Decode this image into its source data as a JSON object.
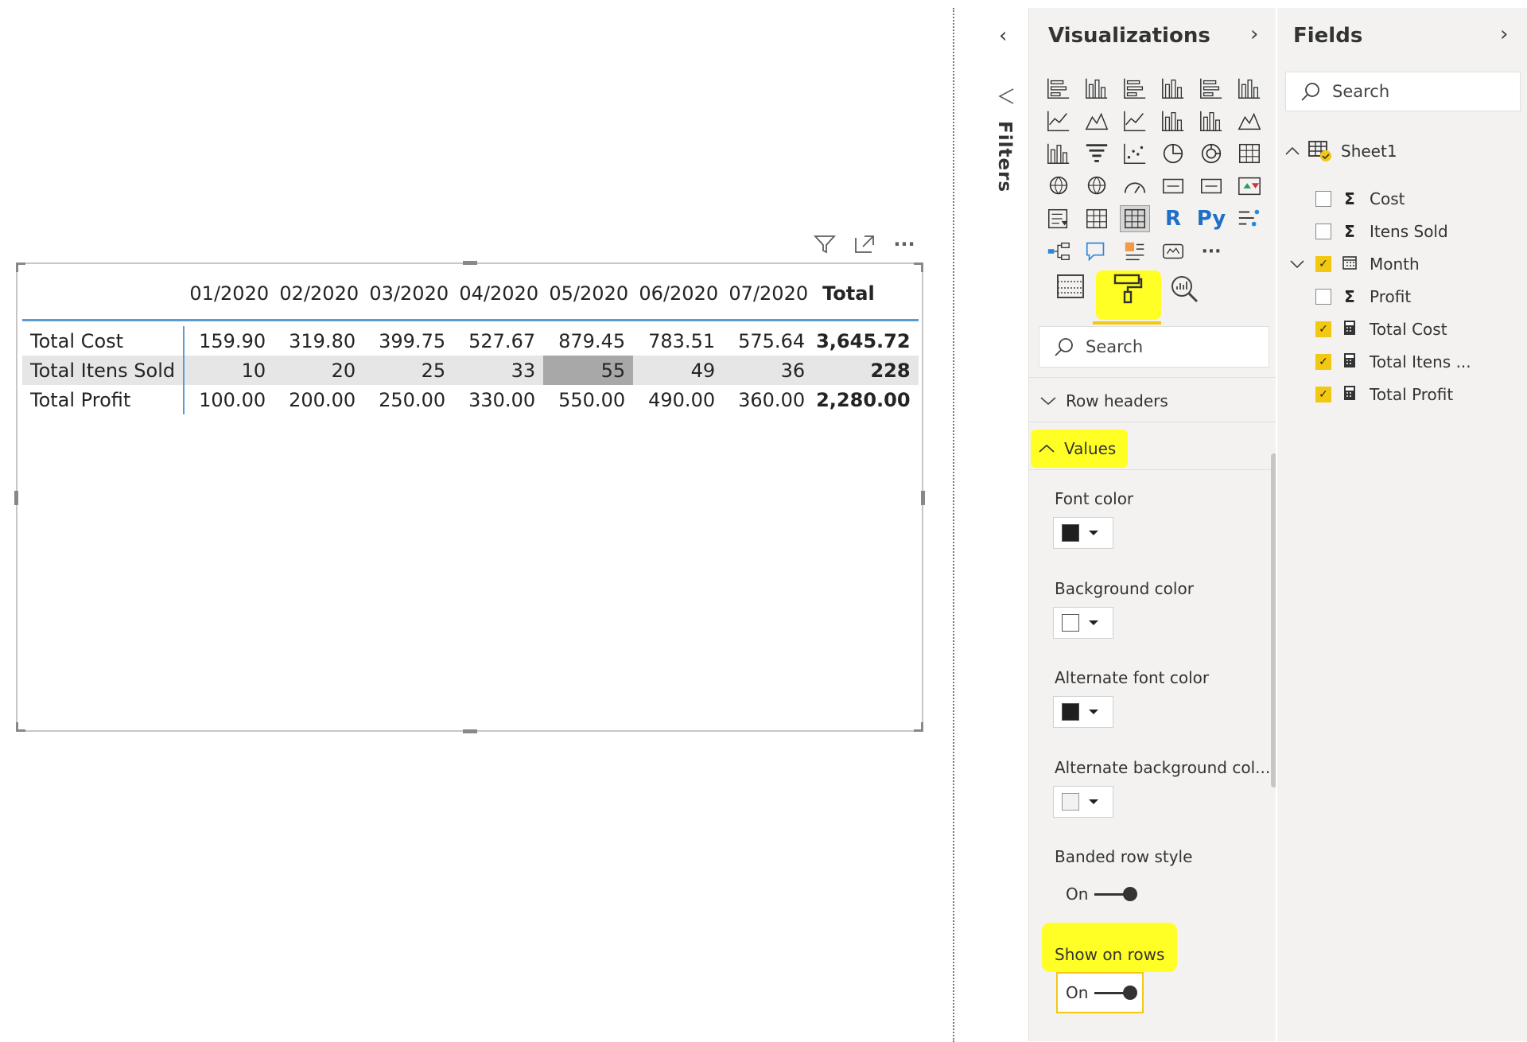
{
  "matrix": {
    "columns": [
      "01/2020",
      "02/2020",
      "03/2020",
      "04/2020",
      "05/2020",
      "06/2020",
      "07/2020"
    ],
    "total_label": "Total",
    "rows": [
      {
        "label": "Total Cost",
        "values": [
          "159.90",
          "319.80",
          "399.75",
          "527.67",
          "879.45",
          "783.51",
          "575.64"
        ],
        "total": "3,645.72"
      },
      {
        "label": "Total Itens Sold",
        "values": [
          "10",
          "20",
          "25",
          "33",
          "55",
          "49",
          "36"
        ],
        "total": "228"
      },
      {
        "label": "Total Profit",
        "values": [
          "100.00",
          "200.00",
          "250.00",
          "330.00",
          "550.00",
          "490.00",
          "360.00"
        ],
        "total": "2,280.00"
      }
    ],
    "selected_cell": "Total Itens Sold / 05/2020"
  },
  "visual_header": {
    "icons": [
      "filter-icon",
      "focus-mode-icon",
      "more-options-icon"
    ],
    "more": "···"
  },
  "filters": {
    "label": "Filters",
    "collapse": "‹"
  },
  "visualizations": {
    "title": "Visualizations",
    "expand": "›",
    "r_label": "R",
    "py_label": "Py",
    "more": "···",
    "search_placeholder": "Search",
    "sections": {
      "row_headers": "Row headers",
      "values": "Values"
    },
    "values_settings": {
      "font_color": "Font color",
      "background_color": "Background color",
      "alternate_font_color": "Alternate font color",
      "alternate_background_color": "Alternate background col...",
      "banded_row_style": "Banded row style",
      "banded_row_state": "On",
      "show_on_rows": "Show on rows",
      "show_on_rows_state": "On"
    },
    "colors": {
      "font": "#252423",
      "background": "#ffffff",
      "alt_font": "#252423",
      "alt_background": "#f3f2f1",
      "highlight": "#ffff26"
    }
  },
  "fields": {
    "title": "Fields",
    "expand": "›",
    "search_placeholder": "Search",
    "table": "Sheet1",
    "items": [
      {
        "name": "Cost",
        "type": "Σ",
        "checked": false
      },
      {
        "name": "Itens Sold",
        "type": "Σ",
        "checked": false
      },
      {
        "name": "Month",
        "type": "calendar",
        "checked": true
      },
      {
        "name": "Profit",
        "type": "Σ",
        "checked": false
      },
      {
        "name": "Total Cost",
        "type": "calculator",
        "checked": true
      },
      {
        "name": "Total Itens ...",
        "type": "calculator",
        "checked": true
      },
      {
        "name": "Total Profit",
        "type": "calculator",
        "checked": true
      }
    ]
  }
}
